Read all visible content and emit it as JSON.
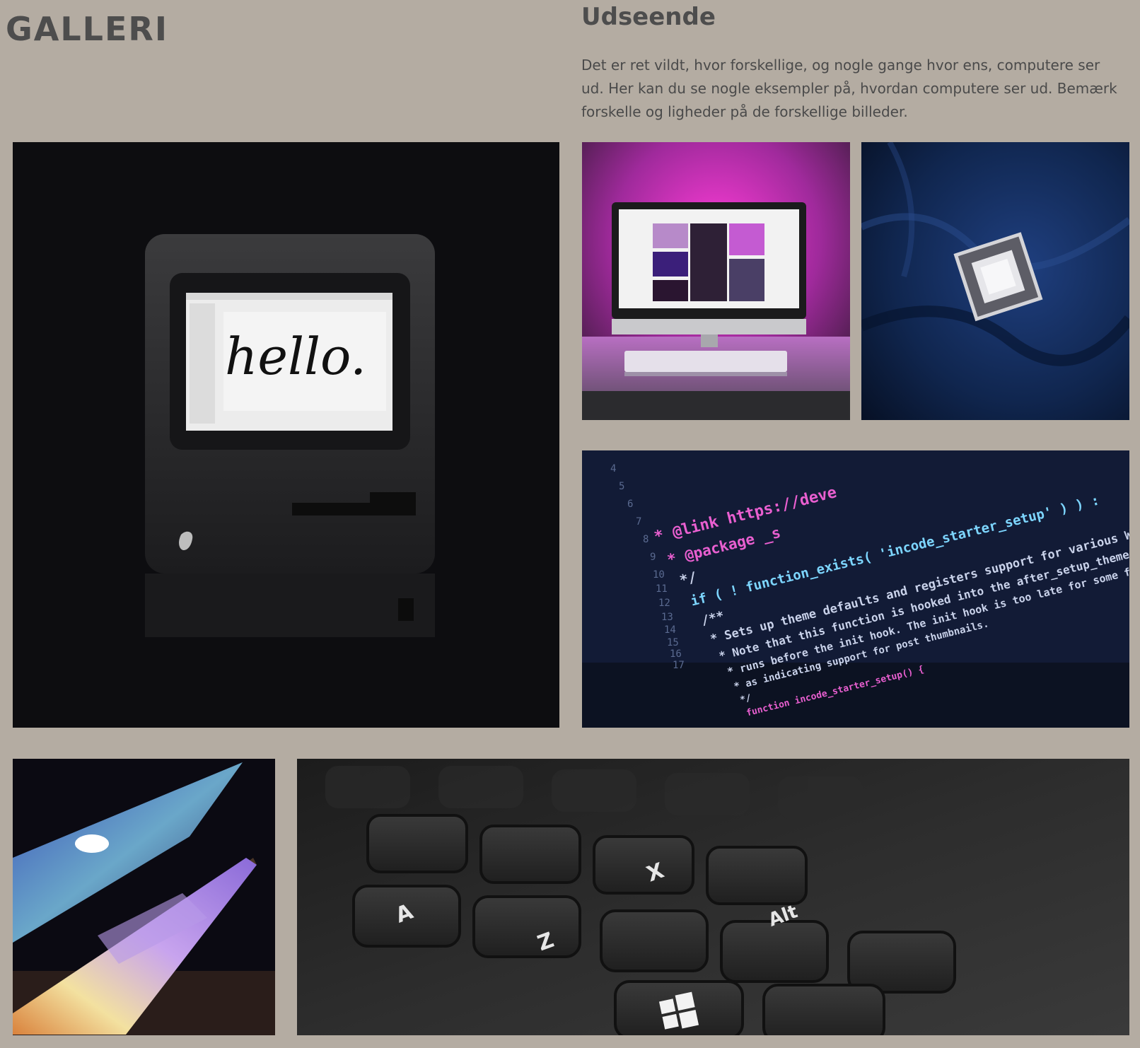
{
  "header": {
    "title": "GALLERI"
  },
  "intro": {
    "heading": "Udseende",
    "text": "Det er ret vildt, hvor forskellige, og nogle gange hvor ens, computere ser ud. Her kan du se nogle eksempler på, hvordan computere ser ud. Bemærk forskelle og ligheder på de forskellige billeder."
  },
  "gallery": {
    "mac_screen_text": "hello.",
    "code_lines": [
      "* @link https://deve",
      "* @package _s",
      "*/",
      "if ( ! function_exists( 'incode_starter_setup' ) ) :",
      "/**",
      " * Sets up theme defaults and registers support for various WordPress features.",
      " * Note that this function is hooked into the after_setup_theme hook, which",
      " * runs before the init hook. The init hook is too late for some features, such",
      " * as indicating support for post thumbnails.",
      " */",
      "function incode_starter_setup() {"
    ],
    "line_numbers": [
      "4",
      "5",
      "6",
      "7",
      "8",
      "9",
      "10",
      "11",
      "12",
      "13",
      "14",
      "15",
      "16",
      "17"
    ],
    "keyboard_keys": [
      "A",
      "Z",
      "X",
      "Alt"
    ]
  }
}
